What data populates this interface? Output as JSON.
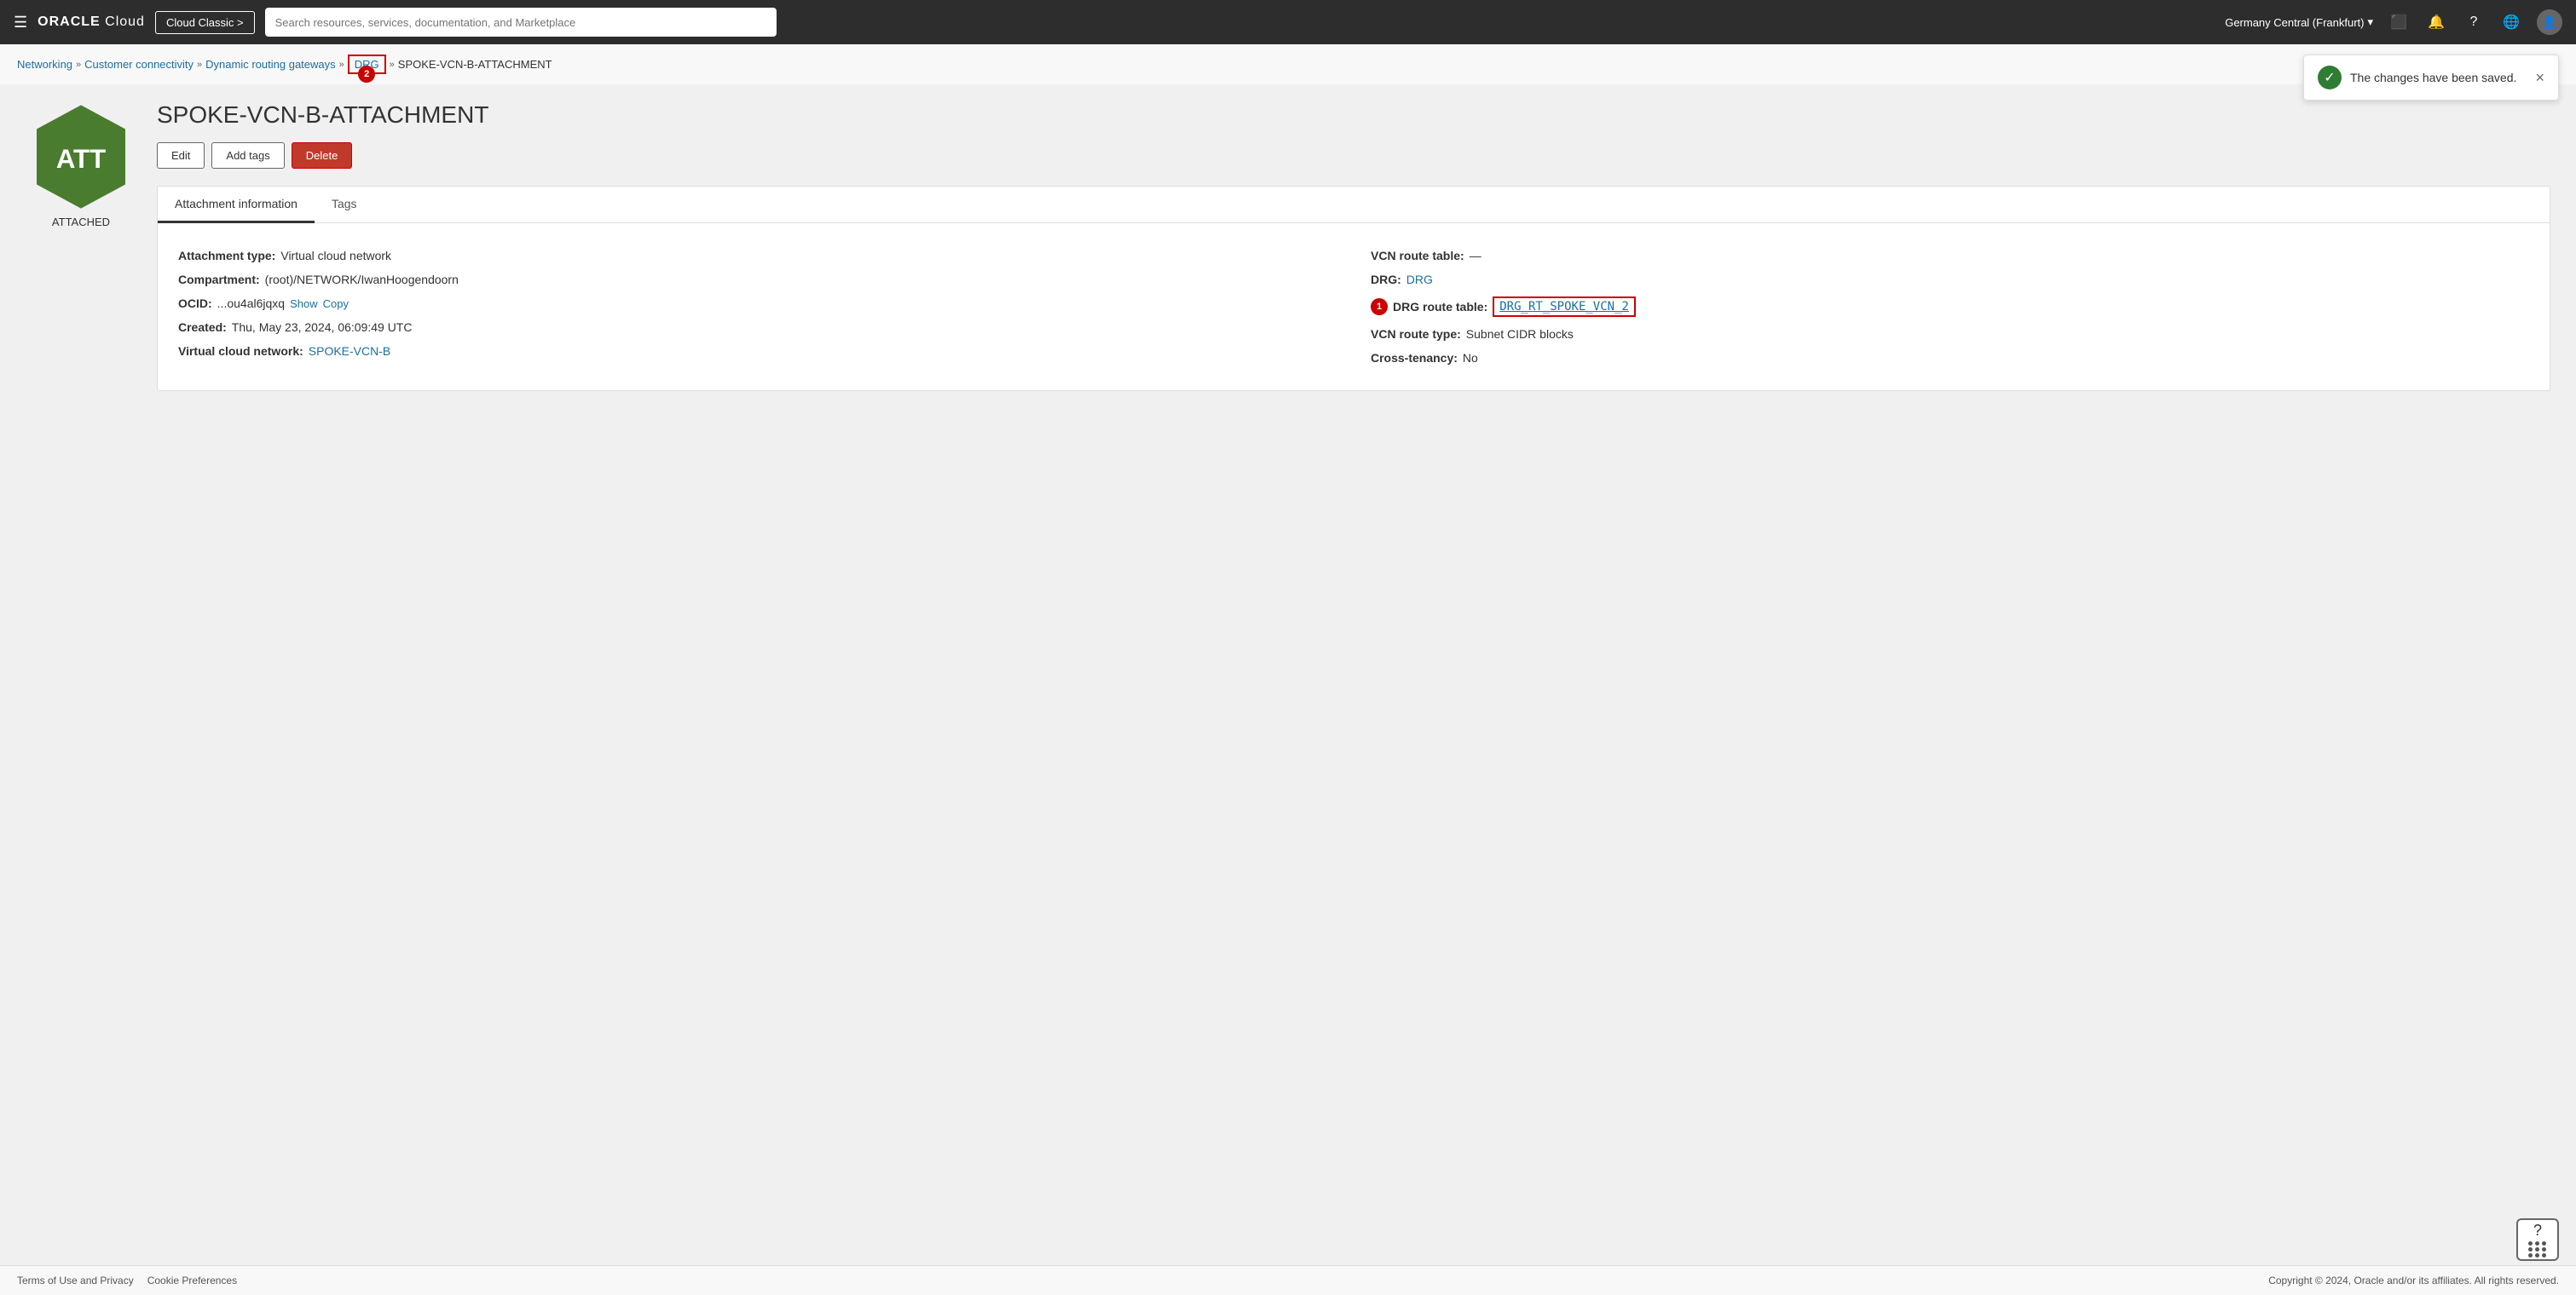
{
  "topnav": {
    "oracle_logo": "ORACLE Cloud",
    "cloud_classic_label": "Cloud Classic >",
    "search_placeholder": "Search resources, services, documentation, and Marketplace",
    "region": "Germany Central (Frankfurt)",
    "region_chevron": "▾"
  },
  "breadcrumb": {
    "networking": "Networking",
    "customer_connectivity": "Customer connectivity",
    "dynamic_routing_gateways": "Dynamic routing gateways",
    "drg": "DRG",
    "current": "SPOKE-VCN-B-ATTACHMENT",
    "badge_drg": "2"
  },
  "toast": {
    "message": "The changes have been saved.",
    "close_label": "×"
  },
  "page": {
    "title": "SPOKE-VCN-B-ATTACHMENT",
    "status": "ATTACHED",
    "hex_text": "ATT"
  },
  "buttons": {
    "edit": "Edit",
    "add_tags": "Add tags",
    "delete": "Delete"
  },
  "tabs": [
    {
      "label": "Attachment information",
      "active": true
    },
    {
      "label": "Tags",
      "active": false
    }
  ],
  "attachment_info": {
    "left": [
      {
        "label": "Attachment type:",
        "value": "Virtual cloud network",
        "type": "text"
      },
      {
        "label": "Compartment:",
        "value": "(root)/NETWORK/IwanHoogendoorn",
        "type": "text"
      },
      {
        "label": "OCID:",
        "value": "...ou4al6jqxq",
        "type": "text",
        "actions": [
          "Show",
          "Copy"
        ]
      },
      {
        "label": "Created:",
        "value": "Thu, May 23, 2024, 06:09:49 UTC",
        "type": "text"
      },
      {
        "label": "Virtual cloud network:",
        "value": "SPOKE-VCN-B",
        "type": "link"
      }
    ],
    "right": [
      {
        "label": "VCN route table:",
        "value": "—",
        "type": "text"
      },
      {
        "label": "DRG:",
        "value": "DRG",
        "type": "link"
      },
      {
        "label": "DRG route table:",
        "value": "DRG_RT_SPOKE_VCN_2",
        "type": "link_highlight",
        "badge": "1"
      },
      {
        "label": "VCN route type:",
        "value": "Subnet CIDR blocks",
        "type": "text"
      },
      {
        "label": "Cross-tenancy:",
        "value": "No",
        "type": "text"
      }
    ]
  },
  "footer": {
    "terms": "Terms of Use and Privacy",
    "cookie": "Cookie Preferences",
    "copyright": "Copyright © 2024, Oracle and/or its affiliates. All rights reserved."
  }
}
